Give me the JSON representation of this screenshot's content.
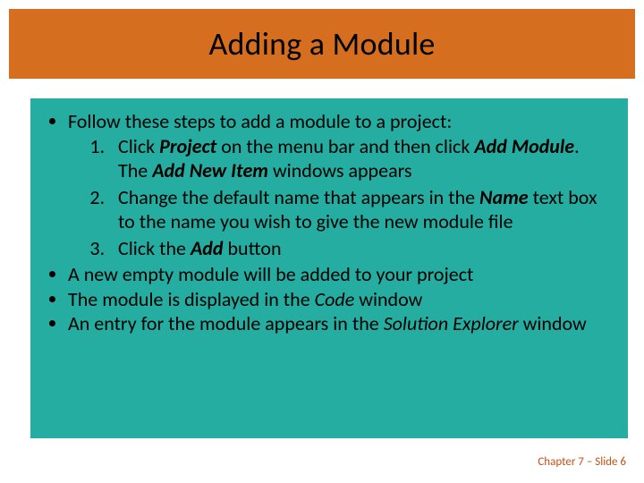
{
  "title": "Adding a Module",
  "bullets": {
    "intro": "Follow these steps to add a module to a project:",
    "steps": {
      "s1_a": "Click ",
      "s1_b": "Project",
      "s1_c": " on the menu bar and then click ",
      "s1_d": "Add Module",
      "s1_e": ". The ",
      "s1_f": "Add New Item",
      "s1_g": " windows appears",
      "s2_a": "Change the default name that appears in the ",
      "s2_b": "Name",
      "s2_c": " text box to the name you wish to give the new module file",
      "s3_a": "Click the ",
      "s3_b": "Add",
      "s3_c": " button"
    },
    "after1": "A new empty module will be added to your project",
    "after2_a": "The module is displayed in the ",
    "after2_b": "Code",
    "after2_c": " window",
    "after3_a": "An entry for the module appears in the ",
    "after3_b": "Solution Explorer",
    "after3_c": " window"
  },
  "footer": "Chapter 7 – Slide 6"
}
